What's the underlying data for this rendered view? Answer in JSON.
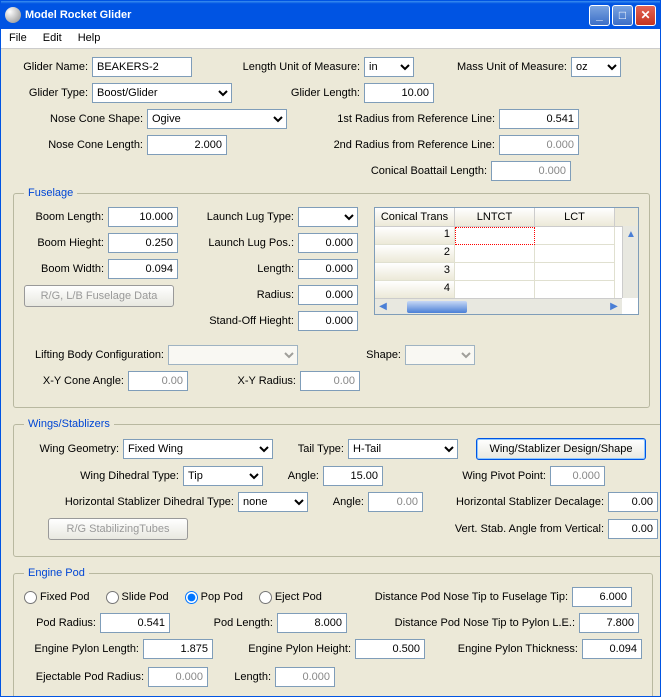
{
  "window": {
    "title": "Model Rocket Glider"
  },
  "menu": {
    "file": "File",
    "edit": "Edit",
    "help": "Help"
  },
  "top": {
    "glider_name_lbl": "Glider Name:",
    "glider_name": "BEAKERS-2",
    "length_unit_lbl": "Length Unit of Measure:",
    "length_unit": "in",
    "mass_unit_lbl": "Mass Unit of Measure:",
    "mass_unit": "oz",
    "glider_type_lbl": "Glider Type:",
    "glider_type": "Boost/Glider",
    "glider_length_lbl": "Glider Length:",
    "glider_length": "10.00",
    "nose_shape_lbl": "Nose Cone Shape:",
    "nose_shape": "Ogive",
    "r1_lbl": "1st Radius from Reference Line:",
    "r1": "0.541",
    "nose_len_lbl": "Nose Cone Length:",
    "nose_len": "2.000",
    "r2_lbl": "2nd Radius from Reference Line:",
    "r2": "0.000",
    "cbt_lbl": "Conical Boattail Length:",
    "cbt": "0.000"
  },
  "fuselage": {
    "legend": "Fuselage",
    "boom_len_lbl": "Boom Length:",
    "boom_len": "10.000",
    "boom_h_lbl": "Boom Hieght:",
    "boom_h": "0.250",
    "boom_w_lbl": "Boom Width:",
    "boom_w": "0.094",
    "lug_type_lbl": "Launch Lug Type:",
    "lug_type": "",
    "lug_pos_lbl": "Launch Lug Pos.:",
    "lug_pos": "0.000",
    "lug_len_lbl": "Length:",
    "lug_len": "0.000",
    "lug_rad_lbl": "Radius:",
    "lug_rad": "0.000",
    "standoff_lbl": "Stand-Off Hieght:",
    "standoff": "0.000",
    "rglb_btn": "R/G, L/B  Fuselage Data",
    "grid": {
      "cols": [
        "Conical Trans",
        "LNTCT",
        "LCT"
      ],
      "rows": [
        "1",
        "2",
        "3",
        "4"
      ]
    },
    "lbc_lbl": "Lifting Body Configuration:",
    "lbc": "",
    "shape_lbl": "Shape:",
    "shape": "",
    "xyca_lbl": "X-Y Cone Angle:",
    "xyca": "0.00",
    "xyr_lbl": "X-Y Radius:",
    "xyr": "0.00"
  },
  "wings": {
    "legend": "Wings/Stablizers",
    "wg_lbl": "Wing Geometry:",
    "wg": "Fixed Wing",
    "tt_lbl": "Tail Type:",
    "tt": "H-Tail",
    "design_btn": "Wing/Stablizer Design/Shape",
    "wd_lbl": "Wing Dihedral    Type:",
    "wd_type": "Tip",
    "wd_ang_lbl": "Angle:",
    "wd_ang": "15.00",
    "wpp_lbl": "Wing Pivot Point:",
    "wpp": "0.000",
    "hsd_lbl": "Horizontal Stablizer Dihedral    Type:",
    "hsd_type": "none",
    "hsd_ang_lbl": "Angle:",
    "hsd_ang": "0.00",
    "hsd_dec_lbl": "Horizontal Stablizer Decalage:",
    "hsd_dec": "0.00",
    "rgst_btn": "R/G StabilizingTubes",
    "vsav_lbl": "Vert. Stab. Angle from Vertical:",
    "vsav": "0.00"
  },
  "engine": {
    "legend": "Engine Pod",
    "fixed": "Fixed Pod",
    "slide": "Slide Pod",
    "pop": "Pop Pod",
    "eject": "Eject Pod",
    "dpnft_lbl": "Distance Pod Nose Tip to Fuselage Tip:",
    "dpnft": "6.000",
    "pod_rad_lbl": "Pod Radius:",
    "pod_rad": "0.541",
    "pod_len_lbl": "Pod Length:",
    "pod_len": "8.000",
    "dpnpl_lbl": "Distance Pod Nose Tip to Pylon L.E.:",
    "dpnpl": "7.800",
    "epl_lbl": "Engine Pylon Length:",
    "epl": "1.875",
    "eph_lbl": "Engine Pylon Height:",
    "eph": "0.500",
    "ept_lbl": "Engine Pylon Thickness:",
    "ept": "0.094",
    "epr_lbl": "Ejectable Pod Radius:",
    "epr": "0.000",
    "epr_len_lbl": "Length:",
    "epr_len": "0.000"
  }
}
